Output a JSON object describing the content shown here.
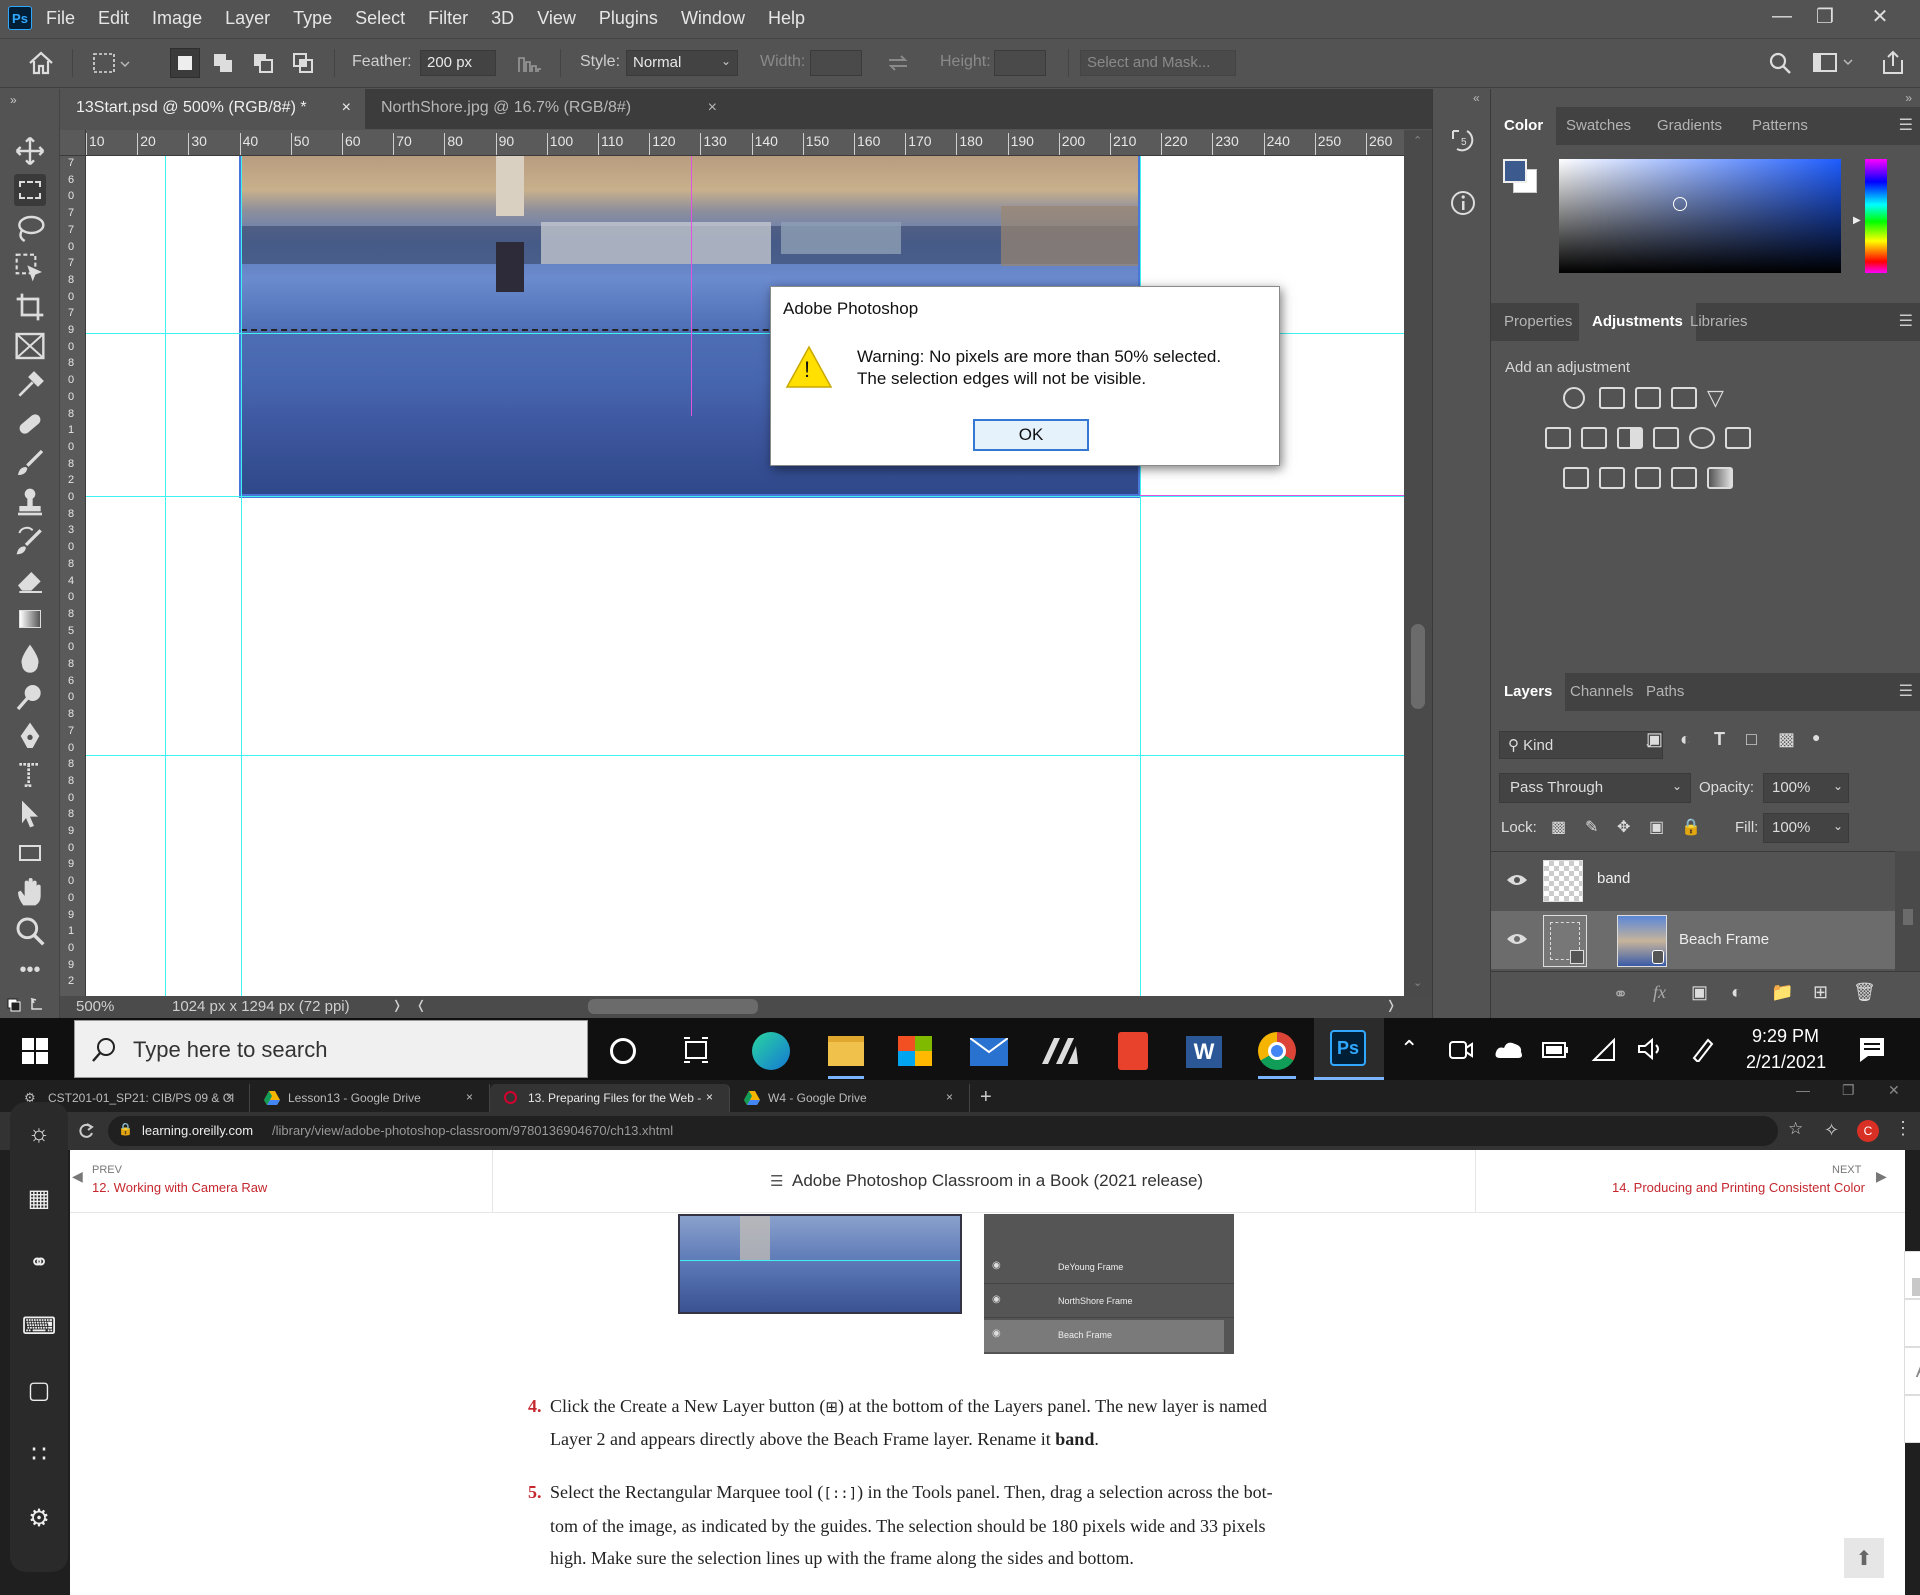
{
  "menu": {
    "items": [
      "File",
      "Edit",
      "Image",
      "Layer",
      "Type",
      "Select",
      "Filter",
      "3D",
      "View",
      "Plugins",
      "Window",
      "Help"
    ],
    "logo": "Ps"
  },
  "window_controls": {
    "minimize": "—",
    "restore": "❐",
    "close": "✕"
  },
  "options": {
    "feather_label": "Feather:",
    "feather_value": "200 px",
    "style_label": "Style:",
    "style_value": "Normal",
    "width_label": "Width:",
    "height_label": "Height:",
    "select_mask": "Select and Mask..."
  },
  "doc_tabs": [
    {
      "label": "13Start.psd @ 500% (RGB/8#) *",
      "close": "×"
    },
    {
      "label": "NorthShore.jpg @ 16.7% (RGB/8#)",
      "close": "×"
    }
  ],
  "ruler": {
    "h_ticks": [
      "10",
      "20",
      "30",
      "40",
      "50",
      "60",
      "70",
      "80",
      "90",
      "100",
      "110",
      "120",
      "130",
      "140",
      "150",
      "160",
      "170",
      "180",
      "190",
      "200",
      "210",
      "220",
      "230",
      "240",
      "250",
      "260",
      "2"
    ],
    "v_ticks": [
      "7",
      "6",
      "0",
      "7",
      "7",
      "0",
      "7",
      "8",
      "0",
      "7",
      "9",
      "0",
      "8",
      "0",
      "0",
      "8",
      "1",
      "0",
      "8",
      "2",
      "0",
      "8",
      "3",
      "0",
      "8",
      "4",
      "0",
      "8",
      "5",
      "0",
      "8",
      "6",
      "0",
      "8",
      "7",
      "0",
      "8",
      "8",
      "0",
      "8",
      "9",
      "0",
      "9",
      "0",
      "0",
      "9",
      "1",
      "0",
      "9",
      "2"
    ]
  },
  "status": {
    "zoom": "500%",
    "doc_info": "1024 px x 1294 px (72 ppi)",
    "arrow": "❭",
    "arrow_left": "❬"
  },
  "dialog": {
    "title": "Adobe Photoshop",
    "line1": "Warning: No pixels are more than 50% selected.",
    "line2": "The selection edges will not be visible.",
    "ok": "OK",
    "warn_glyph": "!"
  },
  "color_panel": {
    "tabs": [
      "Color",
      "Swatches",
      "Gradients",
      "Patterns"
    ],
    "fg_color": "#3d5a8f",
    "bg_color": "#ffffff"
  },
  "props_panel": {
    "tabs": [
      "Properties",
      "Adjustments",
      "Libraries"
    ],
    "add_label": "Add an adjustment"
  },
  "layers_panel": {
    "tabs": [
      "Layers",
      "Channels",
      "Paths"
    ],
    "kind": "Kind",
    "blend": "Pass Through",
    "opacity_label": "Opacity:",
    "opacity": "100%",
    "lock_label": "Lock:",
    "fill_label": "Fill:",
    "fill": "100%",
    "layers": [
      {
        "name": "band"
      },
      {
        "name": "Beach Frame"
      }
    ],
    "fx": "fx"
  },
  "taskbar": {
    "search_placeholder": "Type here to search",
    "time": "9:29 PM",
    "date": "2/21/2021",
    "word": "W",
    "ps": "Ps",
    "avatar": "C"
  },
  "browser": {
    "tabs": [
      "CST201-01_SP21: CIB/PS 09 & Cl",
      "Lesson13 - Google Drive",
      "13. Preparing Files for the Web -",
      "W4 - Google Drive"
    ],
    "tab_close": "×",
    "new_tab": "+",
    "url_domain": "learning.oreilly.com",
    "url_path": "/library/view/adobe-photoshop-classroom/9780136904670/ch13.xhtml",
    "lock_glyph": "🔒"
  },
  "book": {
    "prev_label": "PREV",
    "prev_title": "12. Working with Camera Raw",
    "center_title": "Adobe Photoshop Classroom in a Book (2021 release)",
    "next_label": "NEXT",
    "next_title": "14. Producing and Printing Consistent Color",
    "fig_layers": [
      "DeYoung Frame",
      "NorthShore Frame",
      "Beach Frame"
    ],
    "step4_num": "4.",
    "step4_a": "Click the Create a New Layer button (",
    "step4_b": ") at the bottom of the Layers panel. The new layer is named",
    "step4_c": "Layer 2 and appears directly above the Beach Frame layer. Rename it ",
    "step4_bold": "band",
    "step4_end": ".",
    "step5_num": "5.",
    "step5_a": "Select the Rectangular Marquee tool (",
    "step5_b": ") in the Tools panel. Then, drag a selection across the bot-",
    "step5_c": "tom of the image, as indicated by the guides. The selection should be 180 pixels wide and 33 pixels",
    "step5_d": "high. Make sure the selection lines up with the frame along the sides and bottom."
  }
}
